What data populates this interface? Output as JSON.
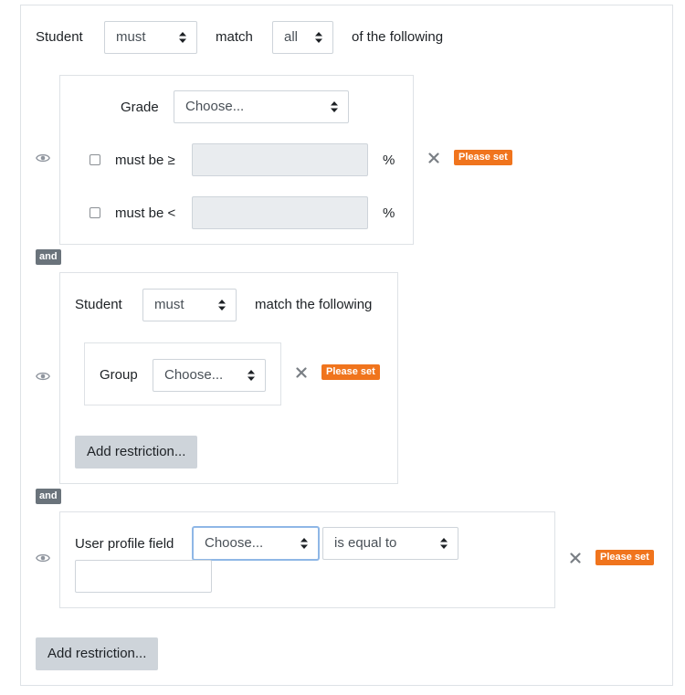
{
  "root": {
    "student_label": "Student",
    "must_select": "must",
    "match_label": "match",
    "all_select": "all",
    "following_label": "of the following",
    "add_restriction": "Add restriction..."
  },
  "grade_condition": {
    "grade_label": "Grade",
    "grade_select": "Choose...",
    "min_label": "must be ≥",
    "max_label": "must be <",
    "percent_symbol": "%",
    "status_badge": "Please set"
  },
  "connector": {
    "and_label": "and"
  },
  "group_condition": {
    "student_label": "Student",
    "must_select": "must",
    "match_following": "match the following",
    "group_label": "Group",
    "group_select": "Choose...",
    "status_badge": "Please set",
    "add_restriction": "Add restriction..."
  },
  "profile_condition": {
    "field_label": "User profile field",
    "field_select": "Choose...",
    "operator_select": "is equal to",
    "status_badge": "Please set"
  },
  "icons": {
    "eye": "eye-icon",
    "delete": "close-icon",
    "arrows": "select-arrows-icon"
  },
  "colors": {
    "badge": "#f0741d",
    "and_badge": "#6a737b",
    "button": "#ced4da",
    "focus": "#8fb7e6"
  }
}
